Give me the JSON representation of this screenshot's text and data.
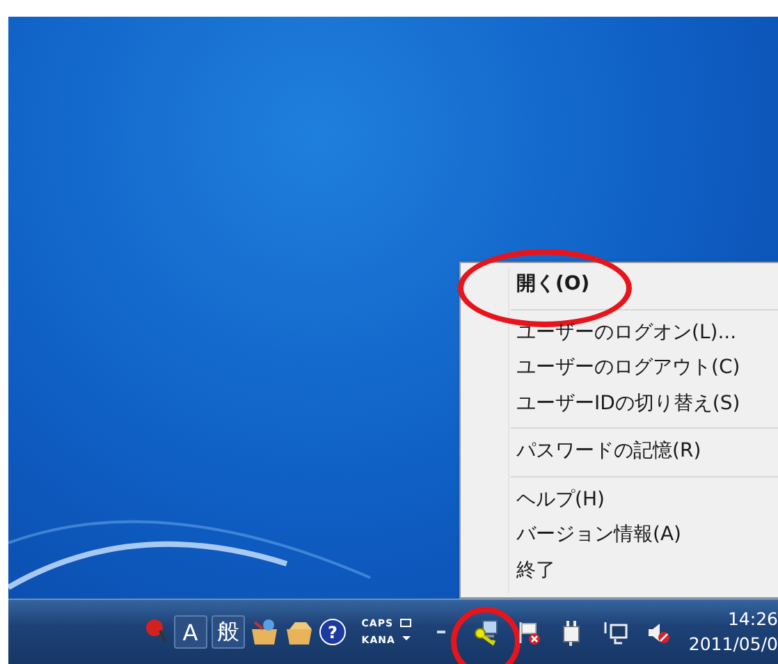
{
  "context_menu": {
    "items": [
      {
        "kind": "item",
        "label": "開く(O)",
        "default": true,
        "circled": true
      },
      {
        "kind": "separator"
      },
      {
        "kind": "item",
        "label": "ユーザーのログオン(L)...",
        "default": false,
        "circled": false
      },
      {
        "kind": "item",
        "label": "ユーザーのログアウト(C)",
        "default": false,
        "circled": false
      },
      {
        "kind": "item",
        "label": "ユーザーIDの切り替え(S)",
        "default": false,
        "circled": false
      },
      {
        "kind": "separator"
      },
      {
        "kind": "item",
        "label": "パスワードの記憶(R)",
        "default": false,
        "circled": false
      },
      {
        "kind": "separator"
      },
      {
        "kind": "item",
        "label": "ヘルプ(H)",
        "default": false,
        "circled": false
      },
      {
        "kind": "item",
        "label": "バージョン情報(A)",
        "default": false,
        "circled": false
      },
      {
        "kind": "item",
        "label": "終了",
        "default": false,
        "circled": false
      }
    ]
  },
  "taskbar": {
    "language_bar": {
      "input_mode": "A",
      "ime_mode": "般",
      "help_glyph": "?",
      "caps": "CAPS",
      "kana": "KANA"
    },
    "tray": [
      {
        "kind": "key-monitor",
        "circled": true
      },
      {
        "kind": "flag-error",
        "circled": false
      },
      {
        "kind": "plug",
        "circled": false
      },
      {
        "kind": "network",
        "circled": false
      },
      {
        "kind": "speaker-muted",
        "circled": false
      }
    ],
    "clock": {
      "time": "14:26",
      "date": "2011/05/0"
    }
  }
}
